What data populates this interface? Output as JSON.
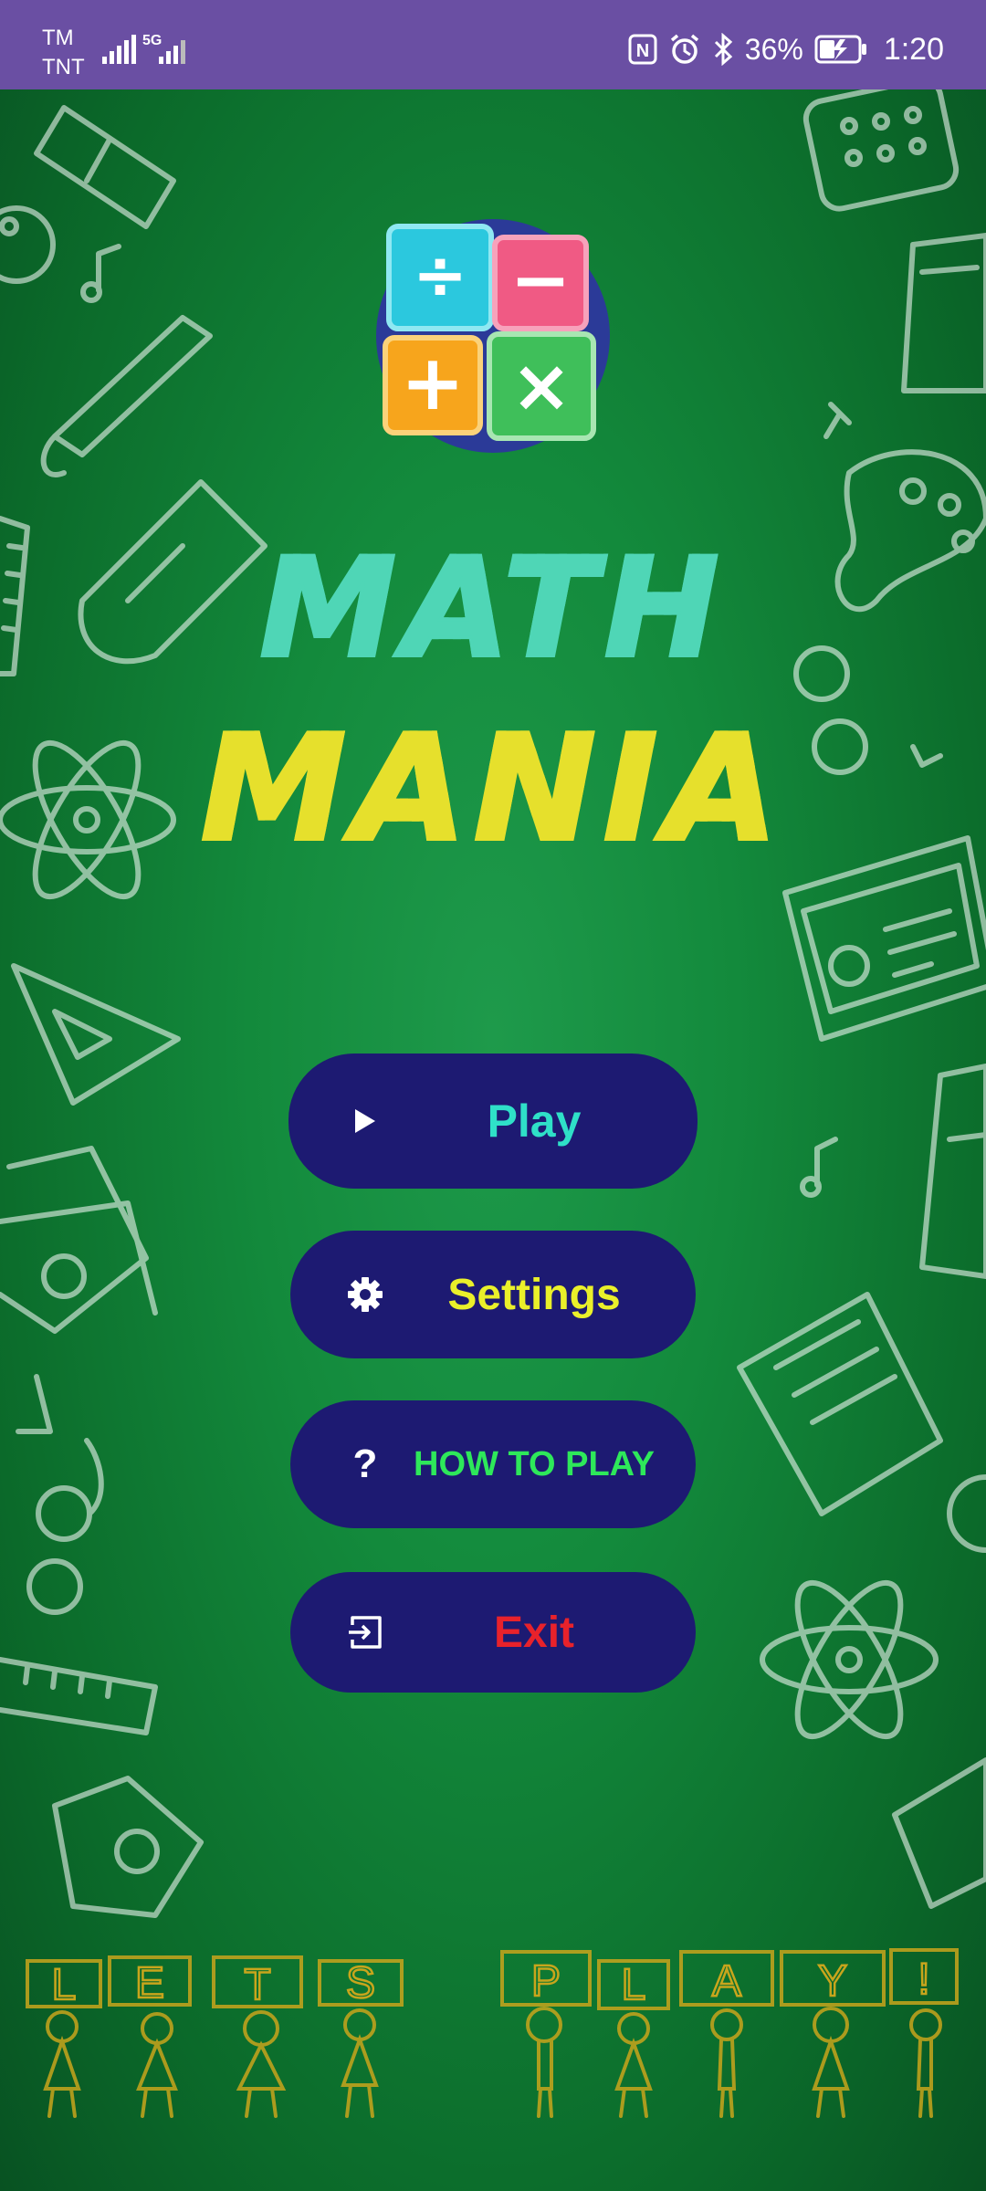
{
  "status_bar": {
    "carrier_1": "TM",
    "carrier_2": "TNT",
    "network": "5G",
    "battery_percent": "36%",
    "time": "1:20"
  },
  "app": {
    "title_line_1": "MATH",
    "title_line_2": "MANIA",
    "logo_symbols": {
      "divide": "÷",
      "minus": "−",
      "plus": "+",
      "times": "×"
    }
  },
  "menu": {
    "play": {
      "label": "Play",
      "icon": "play-icon",
      "color": "#2fe0c8"
    },
    "settings": {
      "label": "Settings",
      "icon": "gear-icon",
      "color": "#eaf02a"
    },
    "how_to_play": {
      "label": "HOW TO PLAY",
      "icon": "question-icon",
      "color": "#2ee85a"
    },
    "exit": {
      "label": "Exit",
      "icon": "exit-icon",
      "color": "#e8222b"
    }
  },
  "footer": {
    "letters": [
      "L",
      "E",
      "T",
      "S",
      "P",
      "L",
      "A",
      "Y",
      "!"
    ]
  },
  "colors": {
    "status_bar": "#6a4fa3",
    "button_bg": "#1d1a72",
    "board": "#138a3c"
  }
}
